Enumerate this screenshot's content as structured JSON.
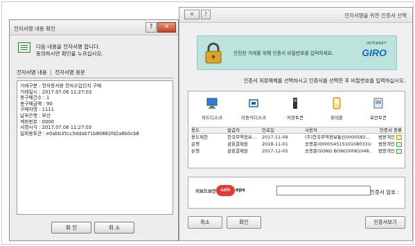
{
  "left_dialog": {
    "title": "전자서명 내용 확인",
    "message_line1": "다음 내용을 전자서명 합니다.",
    "message_line2": "동의하시면 확인을 누르십시오.",
    "tab1": "전자서명 내용",
    "tab_separator": "|",
    "tab2": "전자서명 원문",
    "info_rows": [
      "거래구분 : 전자문서용 전자수입인지 구매",
      "거래일시 : 2017.07.06 11:27:03",
      "총구매건수 : 1",
      "총구매금액 : 90",
      "구매자명 : 1111",
      "납부은행 : 부산",
      "계좌번호 : 0000",
      "서명시각 : 2017.07.06 11:27:03",
      "일회용토큰 : e0abb35cc5ddab71b80882fd2a8b0cb8"
    ],
    "ok_label": "확 인",
    "cancel_label": "취 소"
  },
  "right_dialog": {
    "title": "전자서명을 위한 인증서 선택",
    "banner_text": "안전한 거래를 위해 인증서 비밀번호를 입력하세요.",
    "logo_small": "INTERNET",
    "logo_main": "GIRO",
    "instruction": "인증서 저장매체를 선택하시고 인증서를 선택한 후 비밀번호를 입력하십시오.",
    "storage_items": [
      "보안토큰",
      "휴대폰",
      "저장토큰",
      "이동식디스크",
      "하드디스크"
    ],
    "table_headers": [
      "인증서 종류",
      "사용자",
      "만료일",
      "발급자",
      "용도"
    ],
    "rows": [
      {
        "type": "범용개인",
        "user": "(주)한국무역정보통신0000582...",
        "expiry": "2017-11-09",
        "issuer": "한국무역정보...",
        "use": "용도제한"
      },
      {
        "type": "범용개인",
        "user": "송봉준(0000545151010803316...",
        "expiry": "2018-11-01",
        "issuer": "금융결제원",
        "use": "은행"
      },
      {
        "type": "범용개인",
        "user": "송봉준(SONG BONG)0081048...",
        "expiry": "2017-12-05",
        "issuer": "금융결제원",
        "use": "은행"
      }
    ],
    "password_label": "인증서 암호 :",
    "keyboard_text": "키보드보안",
    "keyboard_brand": "eps",
    "keyboard_badge": "safe",
    "view_button": "인증서보기",
    "confirm_button": "확인",
    "cancel_button": "취소"
  },
  "colors": {
    "banner": "#bde3dd",
    "logo_blue": "#0f6bb5",
    "close_red": "#c4402a",
    "keyboard_red": "#e13b37"
  }
}
